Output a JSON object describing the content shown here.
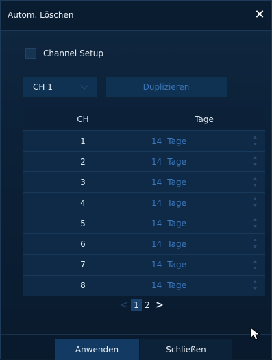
{
  "dialog": {
    "title": "Autom. Löschen",
    "close_glyph": "✕"
  },
  "channel_setup": {
    "label": "Channel Setup",
    "checked": false
  },
  "channel_select": {
    "value": "CH 1"
  },
  "duplicate_button": {
    "label": "Duplizieren"
  },
  "table": {
    "headers": {
      "ch": "CH",
      "tage": "Tage"
    },
    "rows": [
      {
        "ch": "1",
        "num": "14",
        "unit": "Tage"
      },
      {
        "ch": "2",
        "num": "14",
        "unit": "Tage"
      },
      {
        "ch": "3",
        "num": "14",
        "unit": "Tage"
      },
      {
        "ch": "4",
        "num": "14",
        "unit": "Tage"
      },
      {
        "ch": "5",
        "num": "14",
        "unit": "Tage"
      },
      {
        "ch": "6",
        "num": "14",
        "unit": "Tage"
      },
      {
        "ch": "7",
        "num": "14",
        "unit": "Tage"
      },
      {
        "ch": "8",
        "num": "14",
        "unit": "Tage"
      }
    ]
  },
  "pager": {
    "prev": "<",
    "pages": [
      "1",
      "2"
    ],
    "active": "1",
    "next": ">"
  },
  "footer": {
    "apply_label": "Anwenden",
    "close_label": "Schließen"
  },
  "colors": {
    "background": "#0b1d30",
    "accent_text": "#3b78bd",
    "button_active": "#123a62"
  }
}
